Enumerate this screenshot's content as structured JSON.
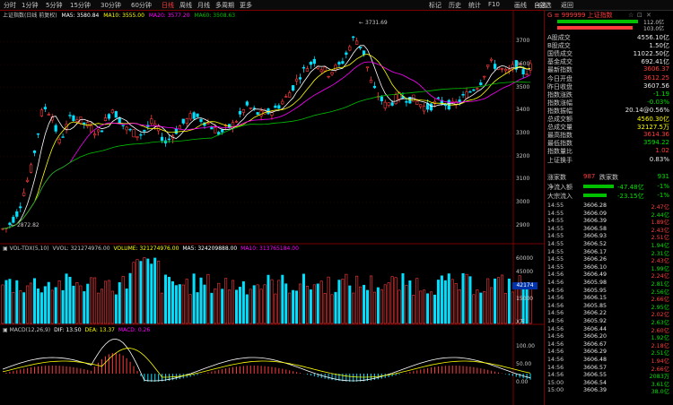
{
  "toolbar": {
    "items": [
      "分时",
      "1分钟",
      "5分钟",
      "15分钟",
      "30分钟",
      "60分钟",
      "日线",
      "周线",
      "月线",
      "多周期",
      "更多"
    ],
    "active_index": 6,
    "right_items": [
      "自选",
      "画线",
      "F10",
      "统计",
      "历史",
      "标记"
    ],
    "right_extra": [
      "-自选",
      "返回"
    ],
    "window_controls": [
      "☆",
      "⊡",
      "✕"
    ]
  },
  "header": {
    "code": "G ≡ 999999 上证指数"
  },
  "main_chart": {
    "title": "上证指数(日线 前复权)",
    "ma5": "MA5: 3580.84",
    "ma10": "MA10: 3555.00",
    "ma20": "MA20: 3577.20",
    "ma60": "MA60: 3508.63",
    "high_label": "3731.69",
    "low_label": "2872.82",
    "y_ticks": [
      "3700",
      "3600",
      "3500",
      "3400",
      "3300",
      "3200",
      "3100",
      "3000",
      "2900"
    ],
    "y_values": [
      3700,
      3600,
      3500,
      3400,
      3300,
      3200,
      3100,
      3000,
      2900
    ]
  },
  "vol_chart": {
    "title": "VOL-TDX(5,10)",
    "vvol": "VVOL: 321274976.00",
    "volume": "VOLUME: 321274976.00",
    "ma5": "MA5: 324209888.00",
    "ma10": "MA10: 313765184.00",
    "y_ticks": [
      "60000",
      "45000",
      "30000",
      "15000"
    ],
    "unit": "X万",
    "current": "42174"
  },
  "macd_chart": {
    "title": "MACD(12,26,9)",
    "dif": "DIF: 13.50",
    "dea": "DEA: 13.37",
    "macd": "MACD: 0.26",
    "y_ticks": [
      "100.00",
      "50.00",
      "0.00"
    ]
  },
  "panel": {
    "bar1": "112.0亿",
    "bar2": "103.0亿",
    "stats": [
      {
        "label": "A股成交",
        "value": "4556.10亿",
        "color": "white"
      },
      {
        "label": "B股成交",
        "value": "1.50亿",
        "color": "white"
      },
      {
        "label": "国债成交",
        "value": "11022.50亿",
        "color": "white"
      },
      {
        "label": "基金成交",
        "value": "692.41亿",
        "color": "white"
      },
      {
        "label": "最新指数",
        "value": "3606.37",
        "color": "red"
      },
      {
        "label": "今日开盘",
        "value": "3612.25",
        "color": "red"
      },
      {
        "label": "昨日收盘",
        "value": "3607.56",
        "color": "white"
      },
      {
        "label": "指数涨跌",
        "value": "-1.19",
        "color": "green"
      },
      {
        "label": "指数涨幅",
        "value": "-0.03%",
        "color": "green"
      },
      {
        "label": "指数振幅",
        "value": "20.14@0.56%",
        "color": "white"
      },
      {
        "label": "总成交额",
        "value": "4560.30亿",
        "color": "yellow"
      },
      {
        "label": "总成交量",
        "value": "32127.5万",
        "color": "yellow"
      },
      {
        "label": "最高指数",
        "value": "3614.36",
        "color": "red"
      },
      {
        "label": "最低指数",
        "value": "3594.22",
        "color": "green"
      },
      {
        "label": "指数量比",
        "value": "1.02",
        "color": "red"
      },
      {
        "label": "上证换手",
        "value": "0.83%",
        "color": "white"
      }
    ],
    "updown": {
      "up_label": "涨家数",
      "up": "987",
      "down_label": "跌家数",
      "down": "931"
    },
    "flows": [
      {
        "label": "净流入额",
        "value": "-47.48亿",
        "pct": "-1%"
      },
      {
        "label": "大宗流入",
        "value": "-23.15亿",
        "pct": "-1%"
      }
    ],
    "ticks": [
      [
        "14:55",
        "3606.28",
        "2.47亿",
        "red"
      ],
      [
        "14:55",
        "3606.09",
        "2.44亿",
        "green"
      ],
      [
        "14:55",
        "3606.39",
        "1.89亿",
        "red"
      ],
      [
        "14:55",
        "3606.58",
        "2.43亿",
        "red"
      ],
      [
        "14:55",
        "3606.93",
        "2.51亿",
        "red"
      ],
      [
        "14:55",
        "3606.52",
        "1.94亿",
        "green"
      ],
      [
        "14:55",
        "3606.17",
        "2.31亿",
        "green"
      ],
      [
        "14:55",
        "3606.26",
        "2.43亿",
        "red"
      ],
      [
        "14:55",
        "3606.10",
        "1.99亿",
        "green"
      ],
      [
        "14:56",
        "3606.49",
        "2.24亿",
        "red"
      ],
      [
        "14:56",
        "3605.98",
        "2.81亿",
        "green"
      ],
      [
        "14:56",
        "3605.95",
        "2.56亿",
        "green"
      ],
      [
        "14:56",
        "3606.15",
        "2.66亿",
        "red"
      ],
      [
        "14:56",
        "3605.85",
        "2.95亿",
        "green"
      ],
      [
        "14:56",
        "3606.22",
        "2.02亿",
        "red"
      ],
      [
        "14:56",
        "3605.92",
        "2.63亿",
        "green"
      ],
      [
        "14:56",
        "3606.44",
        "2.60亿",
        "red"
      ],
      [
        "14:56",
        "3606.20",
        "1.92亿",
        "green"
      ],
      [
        "14:56",
        "3606.67",
        "2.18亿",
        "red"
      ],
      [
        "14:56",
        "3606.29",
        "2.51亿",
        "green"
      ],
      [
        "14:56",
        "3606.48",
        "1.94亿",
        "red"
      ],
      [
        "14:56",
        "3606.57",
        "2.66亿",
        "red"
      ],
      [
        "14:56",
        "3606.55",
        "2083万",
        "green"
      ],
      [
        "15:00",
        "3606.54",
        "3.61亿",
        "green"
      ],
      [
        "15:00",
        "3606.39",
        "38.0亿",
        "green"
      ]
    ]
  },
  "colors": {
    "up": "#ff3b3b",
    "down": "#00e0ff",
    "ma5": "#ffffff",
    "ma10": "#ffff00",
    "ma20": "#ff00ff",
    "ma60": "#00c000",
    "border": "#7a0000"
  }
}
